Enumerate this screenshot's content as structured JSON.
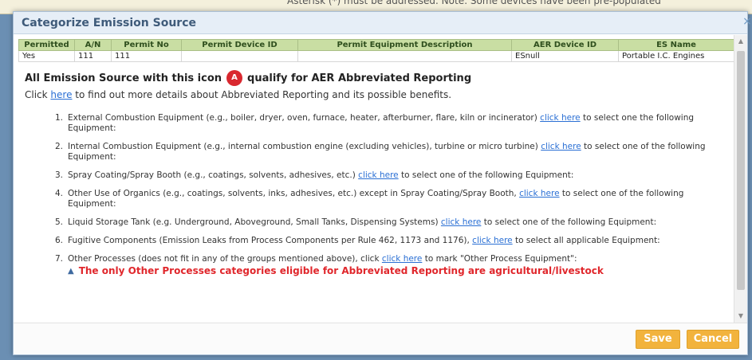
{
  "background": {
    "partial_text": "Asterisk (*) must be addressed. Note: Some devices have been pre-populated"
  },
  "dialog": {
    "title": "Categorize Emission Source",
    "close_symbol": "×"
  },
  "table": {
    "headers": [
      "Permitted",
      "A/N",
      "Permit No",
      "Permit Device ID",
      "Permit Equipment Description",
      "AER Device ID",
      "ES Name"
    ],
    "rows": [
      [
        "Yes",
        "111",
        "111",
        "",
        "",
        "ESnull",
        "Portable I.C. Engines"
      ]
    ]
  },
  "abbreviated": {
    "heading_before": "All Emission Source with this icon",
    "badge": "A",
    "heading_after": "qualify for AER Abbreviated Reporting",
    "intro_before": "Click",
    "intro_link": "here",
    "intro_after": "to find out more details about Abbreviated Reporting and its possible benefits."
  },
  "categories": [
    {
      "num": "1.",
      "before": "External Combustion Equipment (e.g., boiler, dryer, oven, furnace, heater, afterburner, flare, kiln or incinerator)",
      "link": "click here",
      "after": "to select one the following Equipment:"
    },
    {
      "num": "2.",
      "before": "Internal Combustion Equipment (e.g., internal combustion engine (excluding vehicles), turbine or micro turbine)",
      "link": "click here",
      "after": "to select one of the following Equipment:"
    },
    {
      "num": "3.",
      "before": "Spray Coating/Spray Booth (e.g., coatings, solvents, adhesives, etc.)",
      "link": "click here",
      "after": "to select one of the following Equipment:"
    },
    {
      "num": "4.",
      "before": "Other Use of Organics (e.g., coatings, solvents, inks, adhesives, etc.) except in Spray Coating/Spray Booth,",
      "link": "click here",
      "after": "to select one of the following Equipment:"
    },
    {
      "num": "5.",
      "before": "Liquid Storage Tank (e.g. Underground, Aboveground, Small Tanks, Dispensing Systems)",
      "link": "click here",
      "after": "to select one of the following Equipment:"
    },
    {
      "num": "6.",
      "before": "Fugitive Components (Emission Leaks from Process Components per Rule 462, 1173 and 1176),",
      "link": "click here",
      "after": "to select all applicable Equipment:"
    },
    {
      "num": "7.",
      "before": "Other Processes (does not fit in any of the groups mentioned above), click",
      "link": "click here",
      "after": "to mark \"Other Process Equipment\":"
    }
  ],
  "warning": {
    "icon": "warning-triangle-icon",
    "glyph": "▲",
    "text": "The only Other Processes categories eligible for Abbreviated Reporting are agricultural/livestock"
  },
  "buttons": {
    "save": "Save",
    "cancel": "Cancel"
  },
  "colors": {
    "header_green": "#c9dea3",
    "badge_red": "#d9282f",
    "warning_red": "#e0272c",
    "button_orange": "#f2b33d",
    "link_blue": "#2a6fd4"
  }
}
